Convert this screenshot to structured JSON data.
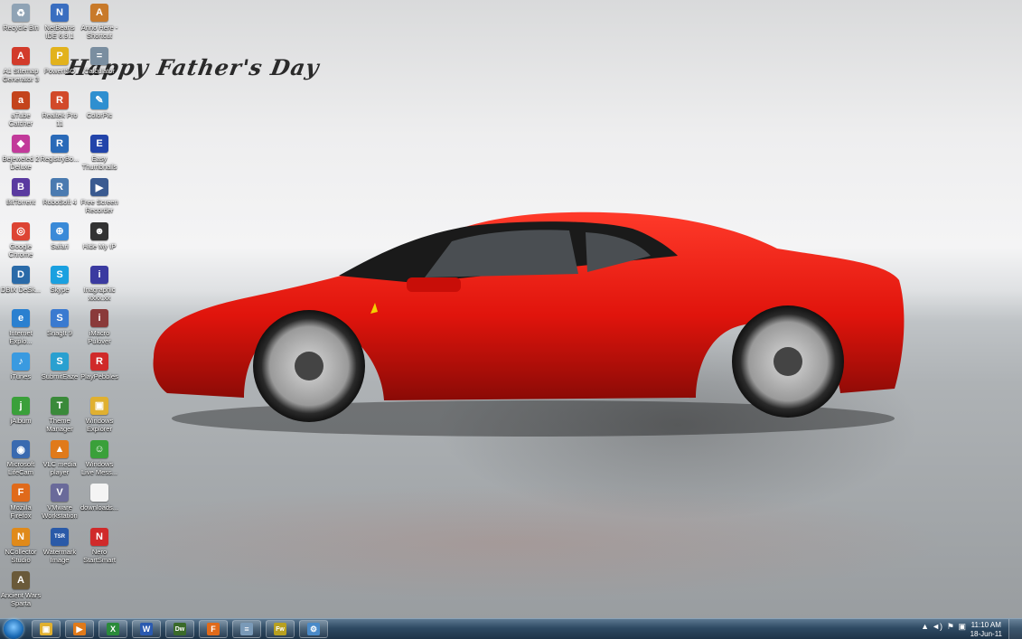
{
  "wallpaper": {
    "greeting": "Happy Father's Day"
  },
  "desktop_icons": [
    {
      "label": "Recycle Bin",
      "icon": "recycle-bin-icon",
      "color": "#8fa3b5",
      "glyph": "♻"
    },
    {
      "label": "NetBeans IDE 6.9.1",
      "icon": "netbeans-icon",
      "color": "#3a6ec0",
      "glyph": "N"
    },
    {
      "label": "Anno Here - Shortcut",
      "icon": "shortcut-icon",
      "color": "#c87a2a",
      "glyph": "A"
    },
    {
      "label": "A1 Sitemap Generator 3",
      "icon": "sitemap-generator-icon",
      "color": "#d23b2b",
      "glyph": "A"
    },
    {
      "label": "PowerISO",
      "icon": "poweriso-icon",
      "color": "#e2b21c",
      "glyph": "P"
    },
    {
      "label": "Calculator",
      "icon": "calculator-icon",
      "color": "#7a8ea0",
      "glyph": "="
    },
    {
      "label": "aTube Catcher",
      "icon": "atube-catcher-icon",
      "color": "#c4441c",
      "glyph": "a"
    },
    {
      "label": "Realtek Pro 11",
      "icon": "realtek-icon",
      "color": "#d24a2a",
      "glyph": "R"
    },
    {
      "label": "ColorPic",
      "icon": "colorpic-icon",
      "color": "#2e8fd0",
      "glyph": "✎"
    },
    {
      "label": "Bejeweled 2 Deluxe",
      "icon": "bejeweled-icon",
      "color": "#c23a9a",
      "glyph": "◆"
    },
    {
      "label": "RegistryBo...",
      "icon": "registry-icon",
      "color": "#2a6ab8",
      "glyph": "R"
    },
    {
      "label": "Easy Thumbnails",
      "icon": "easy-thumbnails-icon",
      "color": "#2244aa",
      "glyph": "E"
    },
    {
      "label": "BitTorrent",
      "icon": "bittorrent-icon",
      "color": "#5a3aa0",
      "glyph": "B"
    },
    {
      "label": "RoboSoft 4",
      "icon": "robosoft-icon",
      "color": "#4a7ab0",
      "glyph": "R"
    },
    {
      "label": "Free Screen Recorder",
      "icon": "screen-recorder-icon",
      "color": "#3a5a90",
      "glyph": "▶"
    },
    {
      "label": "Google Chrome",
      "icon": "chrome-icon",
      "color": "#dd4433",
      "glyph": "◎"
    },
    {
      "label": "Safari",
      "icon": "safari-icon",
      "color": "#3a8ad8",
      "glyph": "⊕"
    },
    {
      "label": "Hide My IP",
      "icon": "hide-my-ip-icon",
      "color": "#333333",
      "glyph": "☻"
    },
    {
      "label": "DBIX DeSk...",
      "icon": "dbix-icon",
      "color": "#2a6aa8",
      "glyph": "D"
    },
    {
      "label": "Skype",
      "icon": "skype-icon",
      "color": "#1aa0e0",
      "glyph": "S"
    },
    {
      "label": "Inagraphic xxxx.xx",
      "icon": "inagraphic-icon",
      "color": "#3a3aa0",
      "glyph": "i"
    },
    {
      "label": "Internet Explo...",
      "icon": "internet-explorer-icon",
      "color": "#2a80d0",
      "glyph": "e"
    },
    {
      "label": "SnagIt 9",
      "icon": "snagit-icon",
      "color": "#3a7ad0",
      "glyph": "S"
    },
    {
      "label": "iMacro Pulover",
      "icon": "imacro-icon",
      "color": "#8a3a3a",
      "glyph": "i"
    },
    {
      "label": "iTunes",
      "icon": "itunes-icon",
      "color": "#3a9ae0",
      "glyph": "♪"
    },
    {
      "label": "SubmitEaze",
      "icon": "submiteaze-icon",
      "color": "#2aa0d0",
      "glyph": "S"
    },
    {
      "label": "PlayPebbles",
      "icon": "playpebbles-icon",
      "color": "#d02a2a",
      "glyph": "R"
    },
    {
      "label": "jAlbum",
      "icon": "jalbum-icon",
      "color": "#3aa03a",
      "glyph": "j"
    },
    {
      "label": "Theme Manager",
      "icon": "theme-manager-icon",
      "color": "#3a8a3a",
      "glyph": "T"
    },
    {
      "label": "Windows Explorer",
      "icon": "windows-explorer-icon",
      "color": "#e0b030",
      "glyph": "▣"
    },
    {
      "label": "Microsoft LifeCam",
      "icon": "lifecam-icon",
      "color": "#3a6ab0",
      "glyph": "◉"
    },
    {
      "label": "VLC media player",
      "icon": "vlc-icon",
      "color": "#e07a1a",
      "glyph": "▲"
    },
    {
      "label": "Windows Live Mess...",
      "icon": "windows-live-messenger-icon",
      "color": "#3aa03a",
      "glyph": "☺"
    },
    {
      "label": "Mozilla Firefox",
      "icon": "firefox-icon",
      "color": "#e06a1a",
      "glyph": "F"
    },
    {
      "label": "VMware Workstation",
      "icon": "vmware-icon",
      "color": "#6a6a9a",
      "glyph": "V"
    },
    {
      "label": "downloads...",
      "icon": "file-icon",
      "color": "#f4f4f4",
      "glyph": " "
    },
    {
      "label": "NCollector Studio",
      "icon": "ncollector-icon",
      "color": "#e08a1a",
      "glyph": "N"
    },
    {
      "label": "Watermark Image",
      "icon": "watermark-icon",
      "color": "#2a5aa8",
      "glyph": "TSR"
    },
    {
      "label": "Nero StartSmart",
      "icon": "nero-icon",
      "color": "#d02a2a",
      "glyph": "N"
    },
    {
      "label": "Ancient Wars Sparta",
      "icon": "ancient-wars-icon",
      "color": "#6a5a3a",
      "glyph": "A"
    }
  ],
  "taskbar": {
    "pinned": [
      {
        "name": "windows-explorer",
        "icon": "folder-icon",
        "color": "#e0b030",
        "glyph": "▣"
      },
      {
        "name": "media-player",
        "icon": "media-player-icon",
        "color": "#e07a1a",
        "glyph": "▶"
      },
      {
        "name": "excel",
        "icon": "excel-icon",
        "color": "#2a8a3a",
        "glyph": "X"
      },
      {
        "name": "word",
        "icon": "word-icon",
        "color": "#2a5ab0",
        "glyph": "W"
      },
      {
        "name": "dreamweaver",
        "icon": "dreamweaver-icon",
        "color": "#3a6a2a",
        "glyph": "Dw"
      },
      {
        "name": "firefox",
        "icon": "firefox-icon",
        "color": "#e06a1a",
        "glyph": "F"
      },
      {
        "name": "notepad",
        "icon": "notepad-icon",
        "color": "#7a9ab8",
        "glyph": "≡"
      },
      {
        "name": "fireworks",
        "icon": "fireworks-icon",
        "color": "#b8a020",
        "glyph": "Fw"
      },
      {
        "name": "network-tool",
        "icon": "network-icon",
        "color": "#4a8ac8",
        "glyph": "⚙"
      }
    ],
    "clock_time": "11:10 AM",
    "clock_date": "18-Jun-11"
  }
}
